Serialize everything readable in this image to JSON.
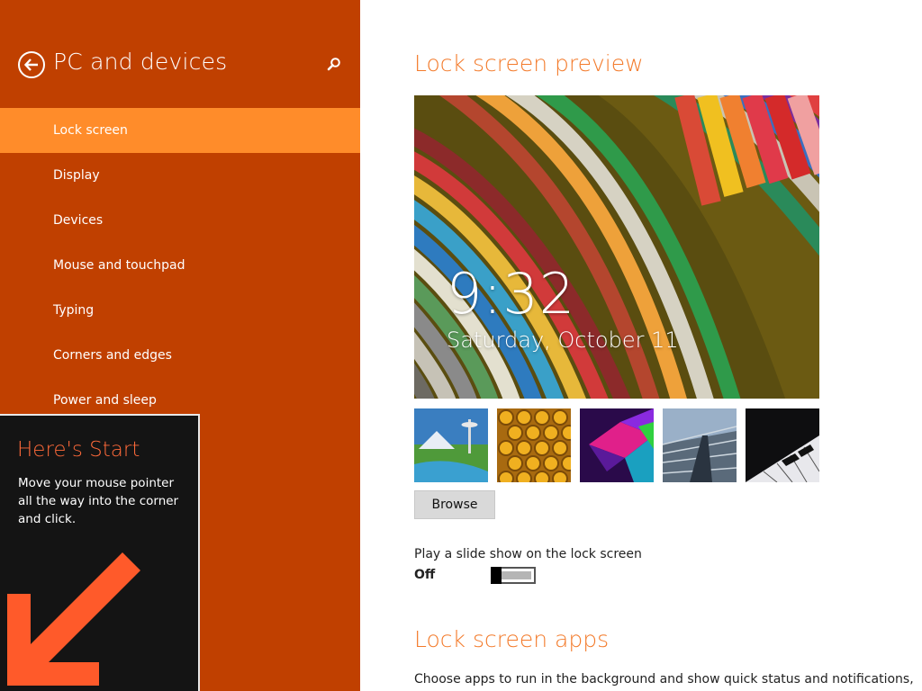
{
  "sidebar": {
    "title": "PC and devices",
    "back_icon": "back-arrow-icon",
    "search_icon": "search-icon",
    "items": [
      {
        "label": "Lock screen",
        "selected": true
      },
      {
        "label": "Display"
      },
      {
        "label": "Devices"
      },
      {
        "label": "Mouse and touchpad"
      },
      {
        "label": "Typing"
      },
      {
        "label": "Corners and edges"
      },
      {
        "label": "Power and sleep"
      }
    ]
  },
  "tip": {
    "title": "Here's Start",
    "body": "Move your mouse pointer all the way into the corner and click."
  },
  "main": {
    "preview_title": "Lock screen preview",
    "preview_time": "9:32",
    "preview_date": "Saturday, October 11",
    "browse_label": "Browse",
    "slideshow_label": "Play a slide show on the lock screen",
    "slideshow_state": "Off",
    "apps_title": "Lock screen apps",
    "apps_description": "Choose apps to run in the background and show quick status and notifications,"
  },
  "colors": {
    "sidebar_bg": "#c04000",
    "selected_bg": "#ff8c2a",
    "accent": "#f37a2a",
    "tip_bg": "#141414",
    "tip_title": "#ff6a3a"
  }
}
